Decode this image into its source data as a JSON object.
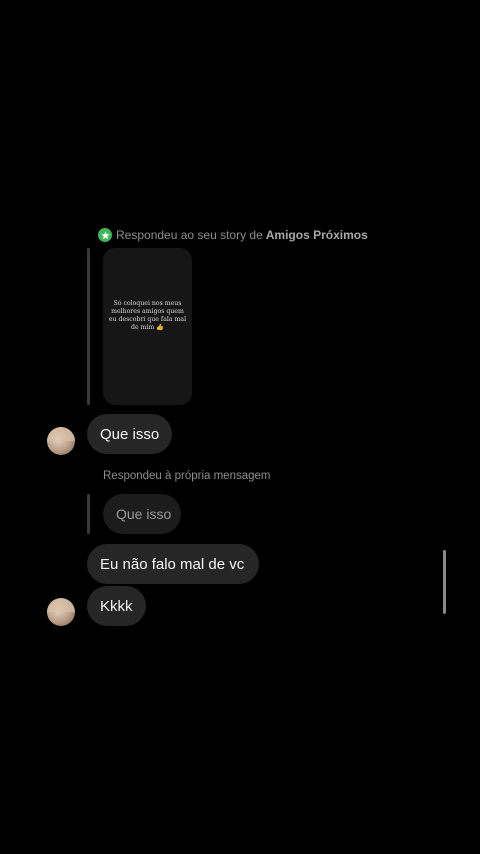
{
  "story_reply": {
    "prefix": "Respondeu ao seu story de",
    "audience": "Amigos Próximos",
    "badge_icon": "star-icon",
    "badge_color": "#3fb65a",
    "story_text": "Só coloquei nos meus melhores amigos quem eu descobri que fala mal de mim 👍"
  },
  "messages": [
    {
      "sender": "other",
      "text": "Que isso"
    },
    {
      "sender": "me",
      "reply_label": "Respondeu à própria mensagem",
      "quoted_text": "Que isso"
    },
    {
      "sender": "other",
      "text": "Eu não falo mal de vc"
    },
    {
      "sender": "other",
      "text": "Kkkk"
    }
  ]
}
